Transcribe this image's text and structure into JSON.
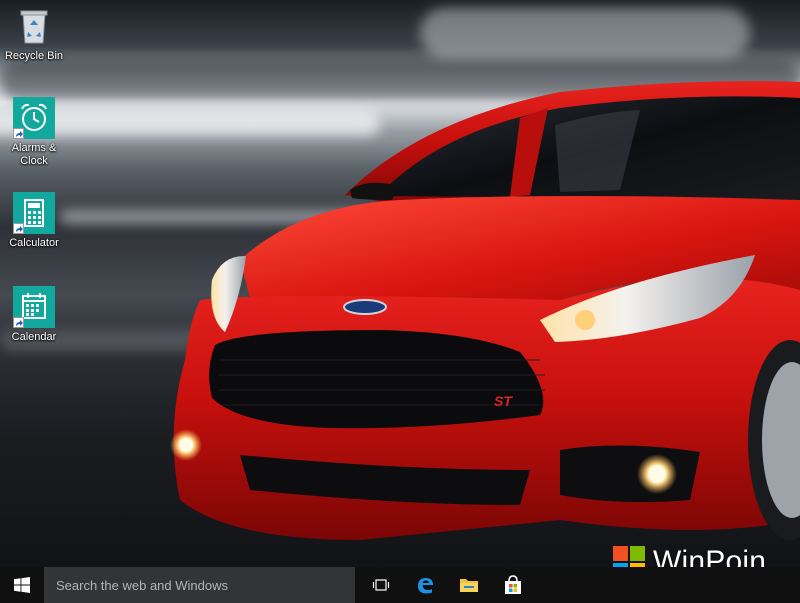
{
  "desktop": {
    "icons": [
      {
        "label": "Recycle Bin",
        "icon": "recycle-bin-icon"
      },
      {
        "label": "Alarms &\nClock",
        "icon": "alarm-clock-icon"
      },
      {
        "label": "Calculator",
        "icon": "calculator-icon"
      },
      {
        "label": "Calendar",
        "icon": "calendar-icon"
      }
    ],
    "tile_color": "#13a89e"
  },
  "wallpaper": {
    "badge_text": "ST"
  },
  "watermark": {
    "text": "WinPoin",
    "logo_colors": [
      "#f25022",
      "#7fba00",
      "#00a4ef",
      "#ffb900"
    ]
  },
  "taskbar": {
    "search_placeholder": "Search the web and Windows",
    "buttons": [
      "start-icon",
      "task-view-icon",
      "edge-icon",
      "file-explorer-icon",
      "store-icon"
    ],
    "background": "#101010"
  }
}
